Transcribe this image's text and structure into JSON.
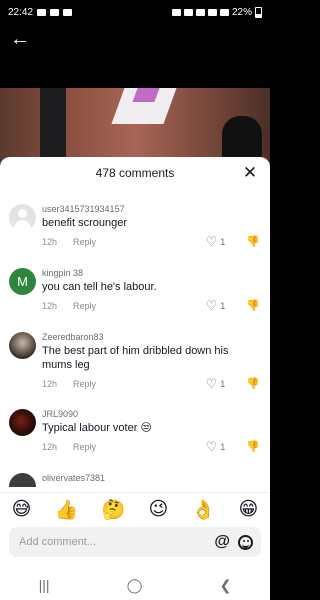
{
  "status_bar": {
    "time": "22:42",
    "battery": "22%"
  },
  "sheet": {
    "title": "478 comments"
  },
  "comments": [
    {
      "username": "user3415731934157",
      "text": "benefit scrounger",
      "time": "12h",
      "reply_label": "Reply",
      "likes": "1"
    },
    {
      "username": "kingpin 38",
      "avatar_letter": "M",
      "text": "you can tell he's labour.",
      "time": "12h",
      "reply_label": "Reply",
      "likes": "1"
    },
    {
      "username": "Zeeredbaron83",
      "text": "The best part of him dribbled down his mums leg",
      "time": "12h",
      "reply_label": "Reply",
      "likes": "1"
    },
    {
      "username": "JRL9090",
      "text": "Typical labour voter 😒",
      "time": "12h",
      "reply_label": "Reply",
      "likes": "1"
    },
    {
      "username": "olivervates7381"
    }
  ],
  "quick_emojis": [
    "😅",
    "👍",
    "🤔",
    "😉",
    "👌",
    "😁"
  ],
  "input": {
    "placeholder": "Add comment...",
    "at_symbol": "@"
  },
  "nav": {
    "recents": "|||",
    "home": "◯",
    "back": "❮"
  }
}
